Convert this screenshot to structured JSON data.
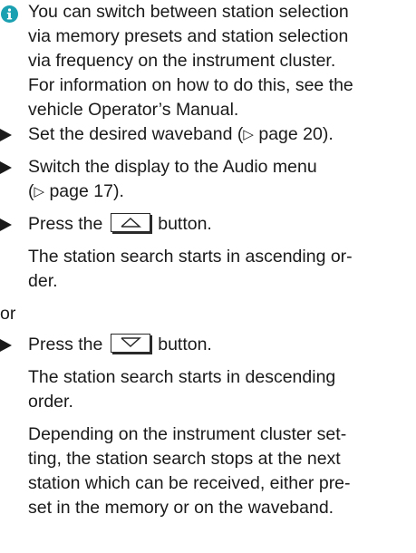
{
  "info_note": {
    "icon": "info-icon",
    "icon_color": "#1aa0b0",
    "lines": [
      "You can switch between station selection",
      "via memory presets and station selection",
      "via frequency on the instrument cluster.",
      "For information on how to do this, see the",
      "vehicle Operator’s Manual."
    ]
  },
  "steps": {
    "step1": {
      "pre": "Set the desired waveband (",
      "ref": "▷",
      "post": " page 20)."
    },
    "step2": {
      "line1": "Switch the display to the Audio menu",
      "line2_pre": "(",
      "ref": "▷",
      "line2_post": " page 17)."
    },
    "step3": {
      "pre": "Press the",
      "button_icon": "seek-up-icon",
      "post": "button.",
      "result_lines": [
        "The station search starts in ascending or-",
        "der."
      ]
    },
    "or_label": "or",
    "step4": {
      "pre": "Press the",
      "button_icon": "seek-down-icon",
      "post": "button.",
      "result_lines": [
        "The station search starts in descending",
        "order."
      ]
    },
    "note_lines": [
      "Depending on the instrument cluster set-",
      "ting, the station search stops at the next",
      "station which can be received, either pre-",
      "set in the memory or on the waveband."
    ]
  }
}
